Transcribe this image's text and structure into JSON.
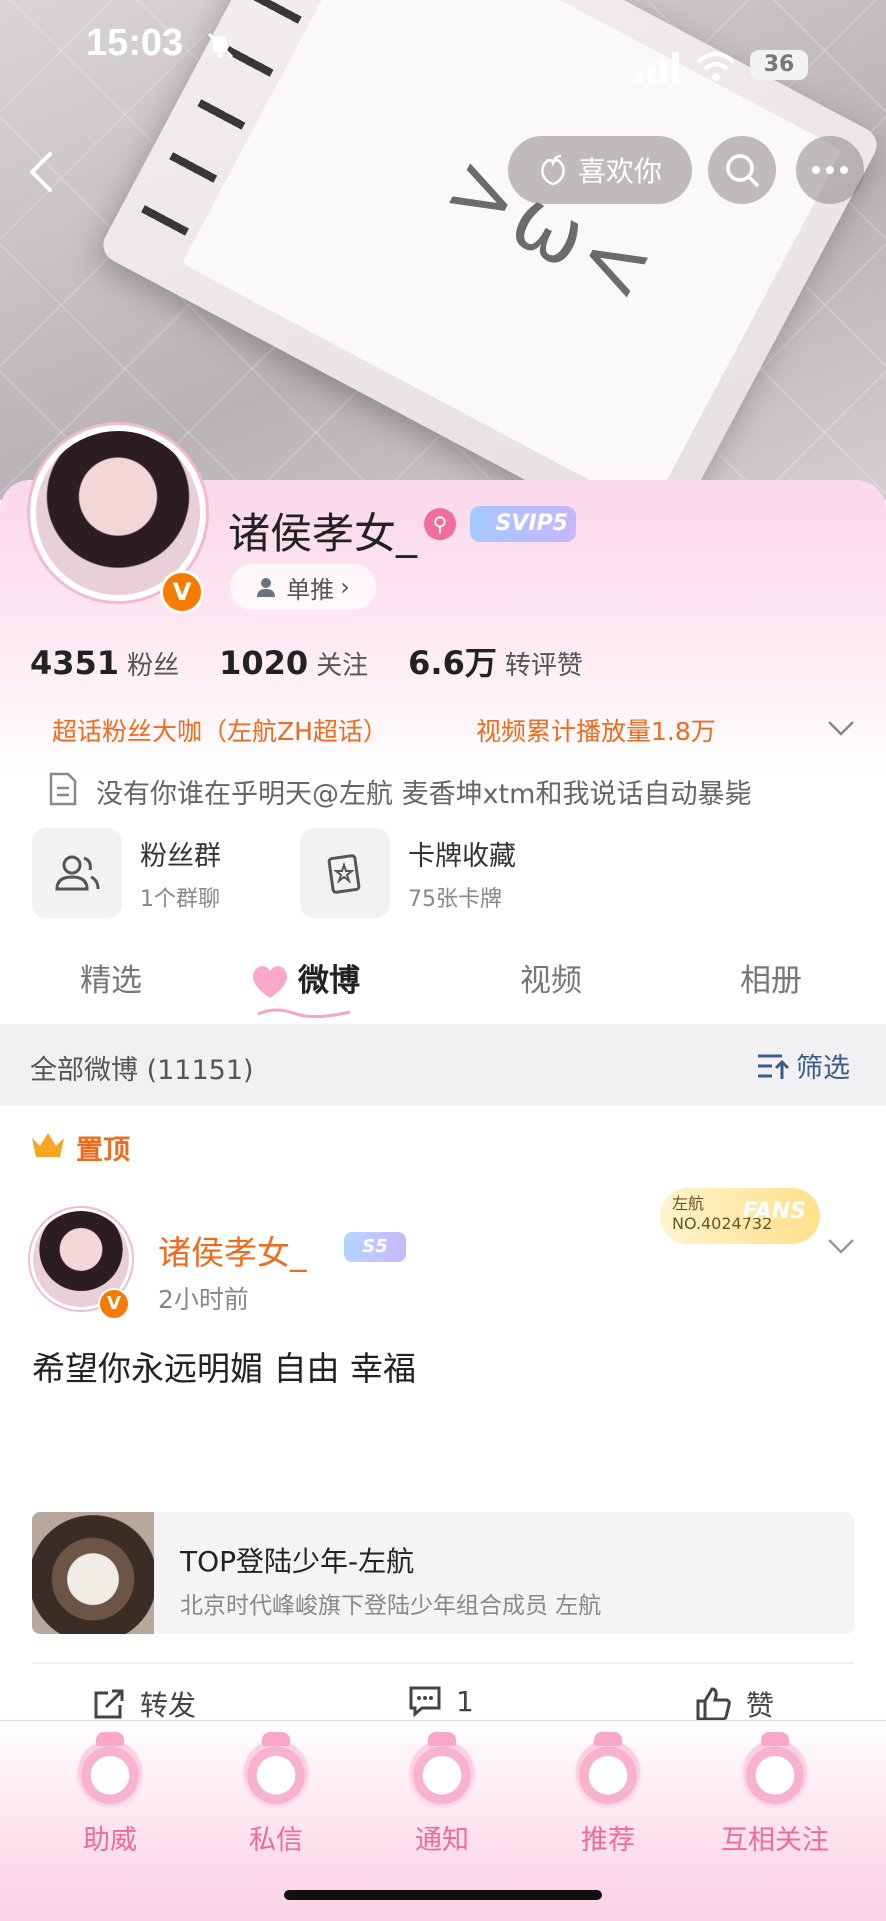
{
  "status_bar": {
    "time": "15:03",
    "battery": "36",
    "icons": [
      "bell-off-icon",
      "signal-icon",
      "wifi-icon",
      "battery-icon"
    ]
  },
  "cover": {
    "decor_text": ">ω<"
  },
  "header": {
    "like_label": "喜欢你",
    "icons": [
      "back-icon",
      "peach-icon",
      "search-icon",
      "more-icon"
    ]
  },
  "profile": {
    "nickname": "诸侯孝女_",
    "svip_badge": "SVIP5",
    "single_push_label": "单推",
    "stats": [
      {
        "value": "4351",
        "label": "粉丝"
      },
      {
        "value": "1020",
        "label": "关注"
      },
      {
        "value": "6.6万",
        "label": "转评赞"
      }
    ],
    "tags": [
      "超话粉丝大咖（左航ZH超话）",
      "视频累计播放量1.8万"
    ],
    "bio": "没有你谁在乎明天@左航   麦香坤xtm和我说话自动暴毙",
    "features": [
      {
        "title": "粉丝群",
        "subtitle": "1个群聊",
        "icon": "users-icon"
      },
      {
        "title": "卡牌收藏",
        "subtitle": "75张卡牌",
        "icon": "card-icon"
      }
    ]
  },
  "tabs": [
    {
      "label": "精选"
    },
    {
      "label": "微博",
      "active": true
    },
    {
      "label": "视频"
    },
    {
      "label": "相册"
    }
  ],
  "filter_bar": {
    "all_label": "全部微博 (11151)",
    "filter_label": "筛选"
  },
  "post": {
    "pinned_label": "置顶",
    "author": "诸侯孝女_",
    "level_badge": "S5",
    "time": "2小时前",
    "fans_card": {
      "name": "左航",
      "number": "NO.4024732",
      "word": "FANS"
    },
    "text": "希望你永远明媚 自由 幸福",
    "link_card": {
      "title": "TOP登陆少年-左航",
      "subtitle": "北京时代峰峻旗下登陆少年组合成员 左航"
    },
    "actions": {
      "repost": "转发",
      "comment": "1",
      "like": "赞"
    }
  },
  "bottom_nav": [
    {
      "label": "助威"
    },
    {
      "label": "私信"
    },
    {
      "label": "通知"
    },
    {
      "label": "推荐"
    },
    {
      "label": "互相关注"
    }
  ],
  "colors": {
    "accent_orange": "#ee6b1e",
    "accent_pink": "#f06a9a",
    "filter_blue": "#3a5b8c",
    "verified_orange": "#f57c00"
  }
}
